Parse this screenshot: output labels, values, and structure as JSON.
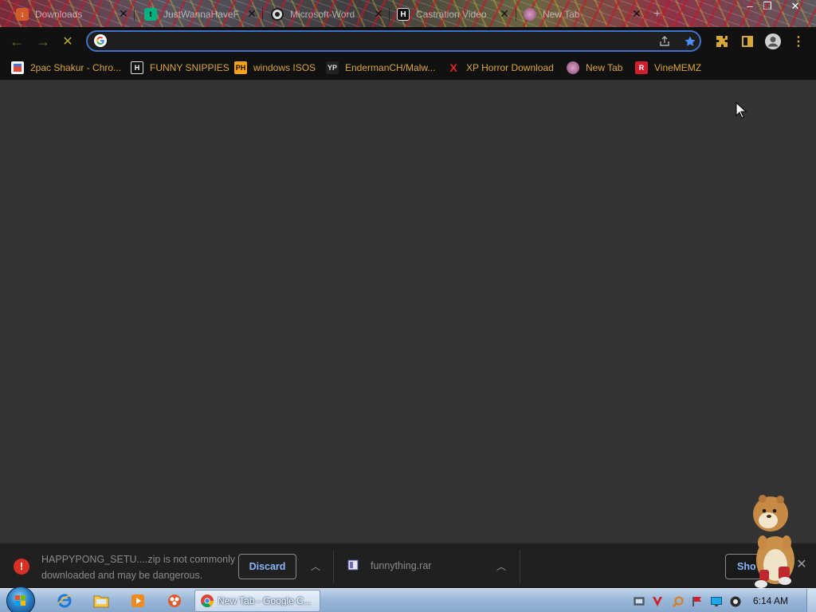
{
  "tabs": [
    {
      "label": "Downloads",
      "favicon": "download-icon",
      "active": false
    },
    {
      "label": "JustWannaHaveF",
      "favicon": "tumblr-icon",
      "active": false
    },
    {
      "label": "Microsoft-Word",
      "favicon": "github-icon",
      "active": false
    },
    {
      "label": "Castration Video",
      "favicon": "h-site-icon",
      "active": false
    },
    {
      "label": "New Tab",
      "favicon": "chrome-newtab-icon",
      "active": true
    }
  ],
  "window_controls": {
    "minimize": "–",
    "maximize": "❐",
    "close": "✕"
  },
  "toolbar": {
    "back": "←",
    "forward": "→",
    "stop": "✕",
    "omnibox_value": "",
    "omnibox_placeholder": "",
    "accent": "#3f73c9",
    "bookmark_star_color": "#4c8df6",
    "nav_color": "#6b6a2a"
  },
  "bookmarks": [
    {
      "label": "2pac Shakur - Chro...",
      "icon": "store-icon"
    },
    {
      "label": "FUNNY SNIPPIES",
      "icon": "h-site-icon"
    },
    {
      "label": "windows ISOS",
      "icon": "ph-icon"
    },
    {
      "label": "EndermanCH/Malw...",
      "icon": "yp-icon"
    },
    {
      "label": "XP Horror Download",
      "icon": "x-red-icon"
    },
    {
      "label": "New Tab",
      "icon": "chrome-newtab-icon"
    },
    {
      "label": "VineMEMZ",
      "icon": "r-red-icon"
    }
  ],
  "bookmark_text_color": "#d9a63a",
  "download_shelf": {
    "warning_line1": "HAPPYPONG_SETU....zip is not commonly",
    "warning_line2": "downloaded and may be dangerous.",
    "discard_label": "Discard",
    "file_name": "funnything.rar",
    "show_all_label": "Sho",
    "warning_color": "#d93025",
    "button_text_color": "#8ab4f8"
  },
  "taskbar": {
    "pinned": [
      "ie-icon",
      "explorer-icon",
      "media-player-icon",
      "dock-icon"
    ],
    "active_task_label": "New Tab - Google C...",
    "tray": [
      "network-icon",
      "v-app-icon",
      "search-app-icon",
      "flag-icon",
      "monitor-icon",
      "volume-icon"
    ],
    "clock": "6:14 AM"
  }
}
